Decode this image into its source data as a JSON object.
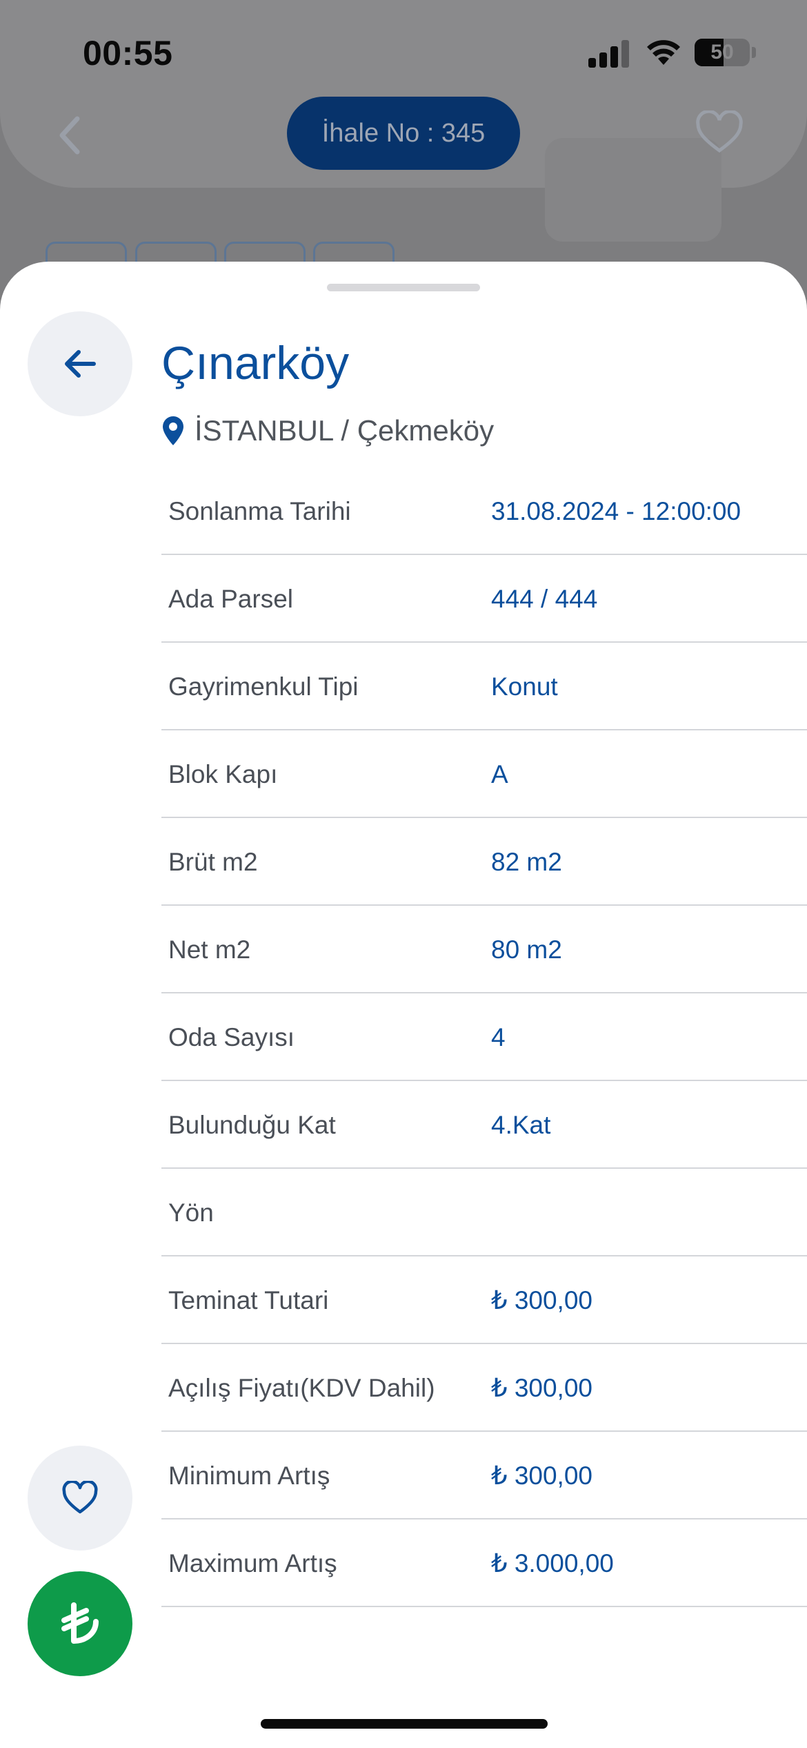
{
  "status_bar": {
    "time": "00:55",
    "battery": "50",
    "battery_level_fraction": 0.5
  },
  "background_page": {
    "auction_number": "İhale No : 345"
  },
  "listing": {
    "title": "Çınarköy",
    "location": "İSTANBUL / Çekmeköy"
  },
  "details": [
    {
      "label": "Sonlanma Tarihi",
      "value": "31.08.2024 - 12:00:00"
    },
    {
      "label": "Ada Parsel",
      "value": "444 / 444"
    },
    {
      "label": "Gayrimenkul Tipi",
      "value": "Konut"
    },
    {
      "label": "Blok Kapı",
      "value": "A"
    },
    {
      "label": "Brüt m2",
      "value": "82 m2"
    },
    {
      "label": "Net m2",
      "value": "80 m2"
    },
    {
      "label": "Oda Sayısı",
      "value": "4"
    },
    {
      "label": "Bulunduğu Kat",
      "value": "4.Kat"
    },
    {
      "label": "Yön",
      "value": ""
    },
    {
      "label": "Teminat Tutari",
      "value": "₺ 300,00"
    },
    {
      "label": "Açılış Fiyatı(KDV Dahil)",
      "value": "₺ 300,00"
    },
    {
      "label": "Minimum Artış",
      "value": "₺ 300,00"
    },
    {
      "label": "Maximum Artış",
      "value": "₺ 3.000,00"
    }
  ],
  "icons": {
    "back": "arrow-left-icon",
    "location": "map-pin-icon",
    "favorite": "heart-icon",
    "bid": "turkish-lira-icon"
  },
  "colors": {
    "primary": "#0b4f9c",
    "accent_green": "#0e9b4a",
    "button_bg": "#eef0f4",
    "label_text": "#4a4f57",
    "pill_bg": "#07336b"
  }
}
